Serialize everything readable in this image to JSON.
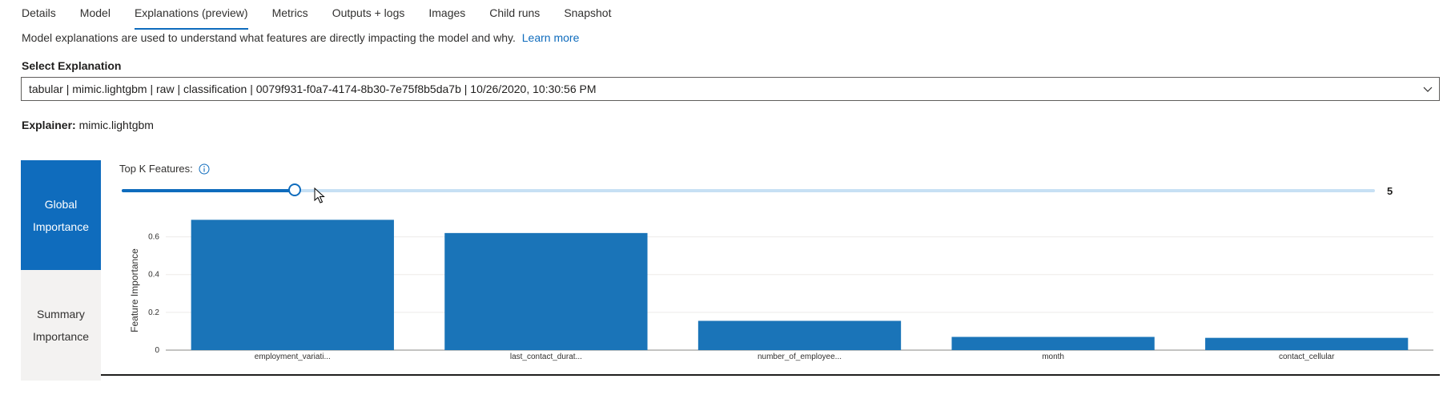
{
  "tabs": [
    {
      "label": "Details",
      "active": false
    },
    {
      "label": "Model",
      "active": false
    },
    {
      "label": "Explanations (preview)",
      "active": true
    },
    {
      "label": "Metrics",
      "active": false
    },
    {
      "label": "Outputs + logs",
      "active": false
    },
    {
      "label": "Images",
      "active": false
    },
    {
      "label": "Child runs",
      "active": false
    },
    {
      "label": "Snapshot",
      "active": false
    }
  ],
  "description": {
    "text": "Model explanations are used to understand what features are directly impacting the model and why.",
    "link": "Learn more"
  },
  "select_explanation": {
    "label": "Select Explanation",
    "value": "tabular | mimic.lightgbm | raw | classification | 0079f931-f0a7-4174-8b30-7e75f8b5da7b | 10/26/2020, 10:30:56 PM",
    "icon": "chevron-down-icon"
  },
  "explainer": {
    "label": "Explainer:",
    "value": "mimic.lightgbm"
  },
  "side_tabs": [
    {
      "label_line1": "Global",
      "label_line2": "Importance",
      "active": true
    },
    {
      "label_line1": "Summary",
      "label_line2": "Importance",
      "active": false
    }
  ],
  "topk": {
    "label": "Top K Features:",
    "value": "5",
    "fraction": 0.14,
    "icon": "info-icon"
  },
  "colors": {
    "accent": "#0f6cbd",
    "bar": "#1a74b8",
    "track": "#c7e0f4"
  },
  "chart_data": {
    "type": "bar",
    "categories": [
      "employment_variati...",
      "last_contact_durat...",
      "number_of_employee...",
      "month",
      "contact_cellular"
    ],
    "values": [
      0.69,
      0.62,
      0.155,
      0.07,
      0.065
    ],
    "ylabel": "Feature Importance",
    "xlabel": "",
    "yticks": [
      "0",
      "0.2",
      "0.4",
      "0.6"
    ],
    "ytick_values": [
      0,
      0.2,
      0.4,
      0.6
    ],
    "ylim": [
      0,
      0.7
    ],
    "grid": true
  }
}
